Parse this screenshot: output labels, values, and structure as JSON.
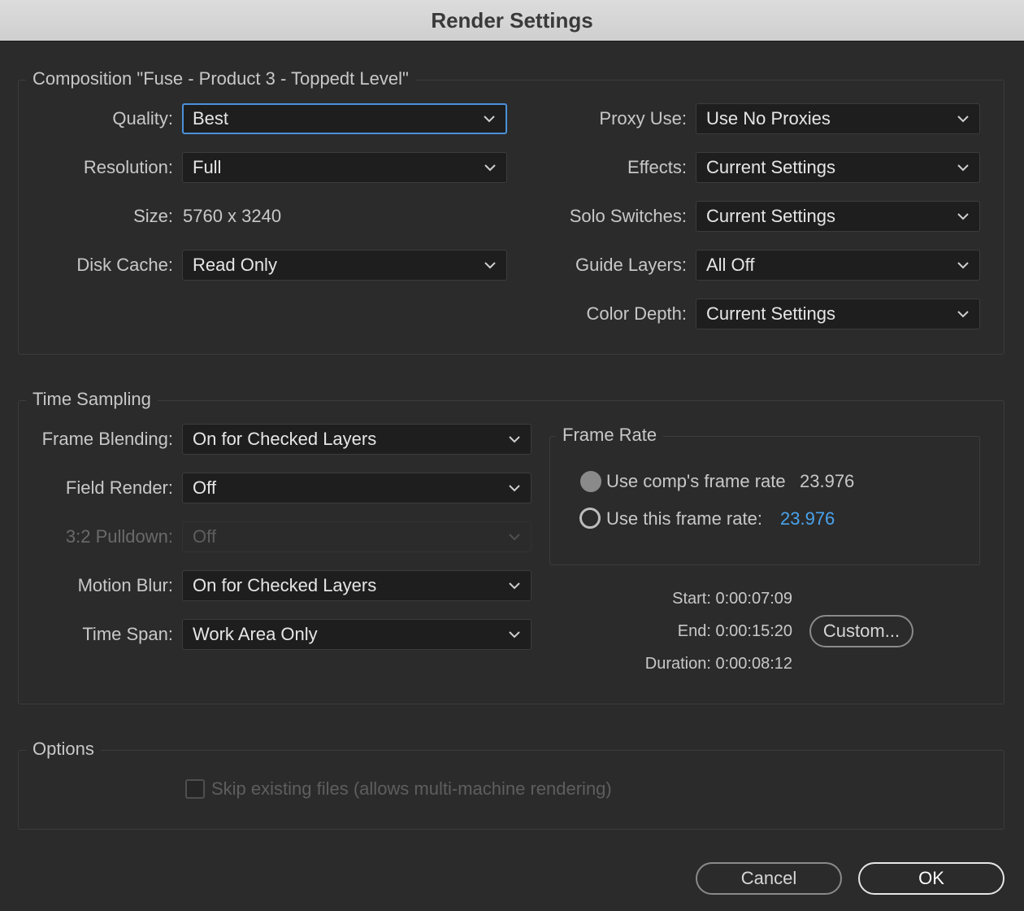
{
  "window": {
    "title": "Render Settings"
  },
  "composition": {
    "legend": "Composition \"Fuse - Product 3 - Toppedt Level\"",
    "quality": {
      "label": "Quality:",
      "value": "Best"
    },
    "resolution": {
      "label": "Resolution:",
      "value": "Full"
    },
    "size": {
      "label": "Size:",
      "value": "5760 x 3240"
    },
    "disk_cache": {
      "label": "Disk Cache:",
      "value": "Read Only"
    },
    "proxy_use": {
      "label": "Proxy Use:",
      "value": "Use No Proxies"
    },
    "effects": {
      "label": "Effects:",
      "value": "Current Settings"
    },
    "solo_switches": {
      "label": "Solo Switches:",
      "value": "Current Settings"
    },
    "guide_layers": {
      "label": "Guide Layers:",
      "value": "All Off"
    },
    "color_depth": {
      "label": "Color Depth:",
      "value": "Current Settings"
    }
  },
  "time_sampling": {
    "legend": "Time Sampling",
    "frame_blending": {
      "label": "Frame Blending:",
      "value": "On for Checked Layers"
    },
    "field_render": {
      "label": "Field Render:",
      "value": "Off"
    },
    "pulldown": {
      "label": "3:2 Pulldown:",
      "value": "Off"
    },
    "motion_blur": {
      "label": "Motion Blur:",
      "value": "On for Checked Layers"
    },
    "time_span": {
      "label": "Time Span:",
      "value": "Work Area Only"
    },
    "frame_rate": {
      "legend": "Frame Rate",
      "use_comp_label": "Use comp's frame rate",
      "comp_rate": "23.976",
      "use_this_label": "Use this frame rate:",
      "this_rate": "23.976"
    },
    "start": {
      "label": "Start:",
      "value": "0:00:07:09"
    },
    "end": {
      "label": "End:",
      "value": "0:00:15:20"
    },
    "duration": {
      "label": "Duration:",
      "value": "0:00:08:12"
    },
    "custom_button": "Custom..."
  },
  "options": {
    "legend": "Options",
    "skip_existing": "Skip existing files (allows multi-machine rendering)"
  },
  "buttons": {
    "cancel": "Cancel",
    "ok": "OK"
  },
  "colors": {
    "accent": "#4a90d9",
    "link": "#4aa3ec",
    "background": "#2b2b2b"
  }
}
